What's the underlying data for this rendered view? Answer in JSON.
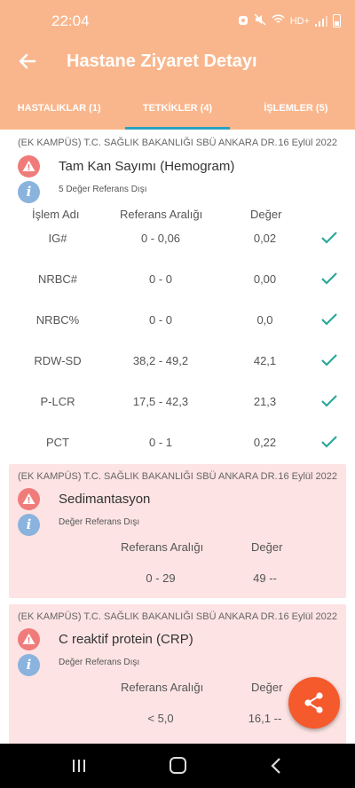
{
  "status_bar": {
    "time": "22:04",
    "network": "HD+"
  },
  "header": {
    "title": "Hastane Ziyaret Detayı"
  },
  "tabs": [
    {
      "label": "HASTALIKLAR (1)"
    },
    {
      "label": "TETKİKLER (4)"
    },
    {
      "label": "İŞLEMLER (5)"
    }
  ],
  "cards": [
    {
      "hospital": "(EK KAMPÜS) T.C. SAĞLIK BAKANLIĞI SBÜ ANKARA DR.",
      "date": "16 Eylül 2022",
      "test_name": "Tam Kan Sayımı (Hemogram)",
      "note": "5 Değer Referans Dışı",
      "columns": {
        "name": "İşlem Adı",
        "range": "Referans Aralığı",
        "value": "Değer"
      },
      "rows": [
        {
          "name": "IG#",
          "range": "0 - 0,06",
          "value": "0,02"
        },
        {
          "name": "NRBC#",
          "range": "0 - 0",
          "value": "0,00"
        },
        {
          "name": "NRBC%",
          "range": "0 - 0",
          "value": "0,0"
        },
        {
          "name": "RDW-SD",
          "range": "38,2 - 49,2",
          "value": "42,1"
        },
        {
          "name": "P-LCR",
          "range": "17,5 - 42,3",
          "value": "21,3"
        },
        {
          "name": "PCT",
          "range": "0 - 1",
          "value": "0,22"
        }
      ]
    },
    {
      "hospital": "(EK KAMPÜS) T.C. SAĞLIK BAKANLIĞI SBÜ ANKARA DR.",
      "date": "16 Eylül 2022",
      "test_name": "Sedimantasyon",
      "note": "Değer Referans Dışı",
      "columns": {
        "range": "Referans Aralığı",
        "value": "Değer"
      },
      "row": {
        "range": "0 - 29",
        "value": "49 --"
      }
    },
    {
      "hospital": "(EK KAMPÜS) T.C. SAĞLIK BAKANLIĞI SBÜ ANKARA DR.",
      "date": "16 Eylül 2022",
      "test_name": "C reaktif protein (CRP)",
      "note": "Değer Referans Dışı",
      "columns": {
        "range": "Referans Aralığı",
        "value": "Değer"
      },
      "row": {
        "range": "< 5,0",
        "value": "16,1 --"
      }
    }
  ],
  "colors": {
    "header": "#f9b68c",
    "alert_card": "#fde3e3",
    "check": "#2aa89a",
    "fab": "#f55a2c",
    "tab_indicator": "#2aa3c0"
  },
  "icons": {
    "back": "arrow-left-icon",
    "warning": "warning-icon",
    "info": "info-icon",
    "check": "check-icon",
    "share": "share-icon"
  }
}
